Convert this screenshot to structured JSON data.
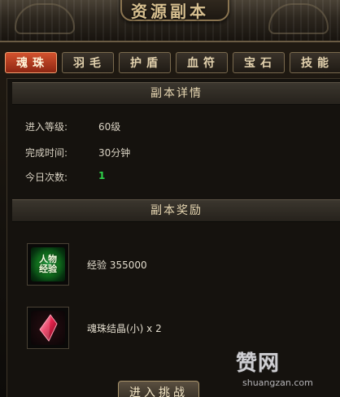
{
  "window": {
    "title": "资源副本"
  },
  "tabs": [
    {
      "label": "魂珠",
      "active": true
    },
    {
      "label": "羽毛",
      "active": false
    },
    {
      "label": "护盾",
      "active": false
    },
    {
      "label": "血符",
      "active": false
    },
    {
      "label": "宝石",
      "active": false
    },
    {
      "label": "技能",
      "active": false
    }
  ],
  "details": {
    "heading": "副本详情",
    "level_label": "进入等级:",
    "level_value": "60级",
    "time_label": "完成时间:",
    "time_value": "30分钟",
    "count_label": "今日次数:",
    "count_value": "1"
  },
  "rewards": {
    "heading": "副本奖励",
    "items": [
      {
        "icon": "exp-orb-icon",
        "icon_text": "人物经验",
        "text": "经验  355000"
      },
      {
        "icon": "red-crystal-icon",
        "text": "魂珠结晶(小) x 2"
      }
    ]
  },
  "actions": {
    "enter_label": "进入挑战"
  },
  "watermark": {
    "logo": "赞网",
    "url": "shuangzan.com"
  },
  "colors": {
    "active_tab": "#c4411f",
    "count_green": "#2fd24a",
    "accent_gold": "#d8c090"
  }
}
